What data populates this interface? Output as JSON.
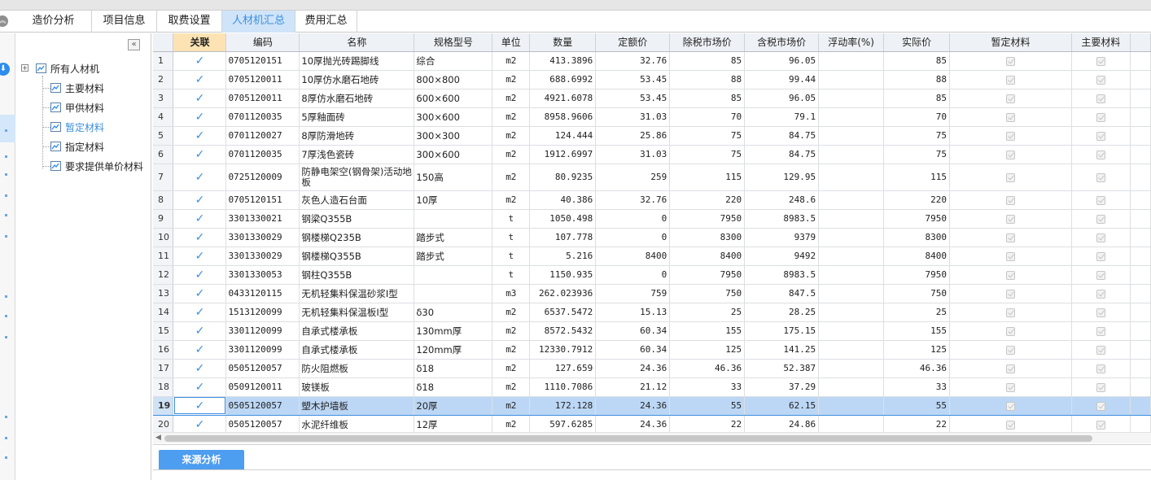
{
  "tabs": [
    {
      "label": "造价分析",
      "active": false
    },
    {
      "label": "项目信息",
      "active": false
    },
    {
      "label": "取费设置",
      "active": false
    },
    {
      "label": "人材机汇总",
      "active": true
    },
    {
      "label": "费用汇总",
      "active": false
    }
  ],
  "tree": {
    "root_label": "所有人材机",
    "items": [
      "主要材料",
      "甲供材料",
      "暂定材料",
      "指定材料",
      "要求提供单价材料"
    ],
    "selected": "暂定材料"
  },
  "grid": {
    "columns": [
      "关联",
      "编码",
      "名称",
      "规格型号",
      "单位",
      "数量",
      "定额价",
      "除税市场价",
      "含税市场价",
      "浮动率(%)",
      "实际价",
      "暂定材料",
      "主要材料"
    ],
    "selected_row": "19",
    "rows": [
      {
        "idx": "1",
        "code": "0705120151",
        "name": "10厚抛光砖踢脚线",
        "spec": "综合",
        "unit": "m2",
        "qty": "413.3896",
        "quota": "32.76",
        "ex_tax": "85",
        "inc_tax": "96.05",
        "float": "",
        "actual": "85"
      },
      {
        "idx": "2",
        "code": "0705120011",
        "name": "10厚仿水磨石地砖",
        "spec": "800×800",
        "unit": "m2",
        "qty": "688.6992",
        "quota": "53.45",
        "ex_tax": "88",
        "inc_tax": "99.44",
        "float": "",
        "actual": "88"
      },
      {
        "idx": "3",
        "code": "0705120011",
        "name": "8厚仿水磨石地砖",
        "spec": "600×600",
        "unit": "m2",
        "qty": "4921.6078",
        "quota": "53.45",
        "ex_tax": "85",
        "inc_tax": "96.05",
        "float": "",
        "actual": "85"
      },
      {
        "idx": "4",
        "code": "0701120035",
        "name": "5厚釉面砖",
        "spec": "300×600",
        "unit": "m2",
        "qty": "8958.9606",
        "quota": "31.03",
        "ex_tax": "70",
        "inc_tax": "79.1",
        "float": "",
        "actual": "70"
      },
      {
        "idx": "5",
        "code": "0701120027",
        "name": "8厚防滑地砖",
        "spec": "300×300",
        "unit": "m2",
        "qty": "124.444",
        "quota": "25.86",
        "ex_tax": "75",
        "inc_tax": "84.75",
        "float": "",
        "actual": "75"
      },
      {
        "idx": "6",
        "code": "0701120035",
        "name": "7厚浅色瓷砖",
        "spec": "300×600",
        "unit": "m2",
        "qty": "1912.6997",
        "quota": "31.03",
        "ex_tax": "75",
        "inc_tax": "84.75",
        "float": "",
        "actual": "75"
      },
      {
        "idx": "7",
        "code": "0725120009",
        "name": "防静电架空(钢骨架)活动地板",
        "spec": "150高",
        "unit": "m2",
        "qty": "80.9235",
        "quota": "259",
        "ex_tax": "115",
        "inc_tax": "129.95",
        "float": "",
        "actual": "115"
      },
      {
        "idx": "8",
        "code": "0705120151",
        "name": "灰色人造石台面",
        "spec": "10厚",
        "unit": "m2",
        "qty": "40.386",
        "quota": "32.76",
        "ex_tax": "220",
        "inc_tax": "248.6",
        "float": "",
        "actual": "220"
      },
      {
        "idx": "9",
        "code": "3301330021",
        "name": "钢梁Q355B",
        "spec": "",
        "unit": "t",
        "qty": "1050.498",
        "quota": "0",
        "ex_tax": "7950",
        "inc_tax": "8983.5",
        "float": "",
        "actual": "7950"
      },
      {
        "idx": "10",
        "code": "3301330029",
        "name": "钢楼梯Q235B",
        "spec": "踏步式",
        "unit": "t",
        "qty": "107.778",
        "quota": "0",
        "ex_tax": "8300",
        "inc_tax": "9379",
        "float": "",
        "actual": "8300"
      },
      {
        "idx": "11",
        "code": "3301330029",
        "name": "钢楼梯Q355B",
        "spec": "踏步式",
        "unit": "t",
        "qty": "5.216",
        "quota": "8400",
        "ex_tax": "8400",
        "inc_tax": "9492",
        "float": "",
        "actual": "8400"
      },
      {
        "idx": "12",
        "code": "3301330053",
        "name": "钢柱Q355B",
        "spec": "",
        "unit": "t",
        "qty": "1150.935",
        "quota": "0",
        "ex_tax": "7950",
        "inc_tax": "8983.5",
        "float": "",
        "actual": "7950"
      },
      {
        "idx": "13",
        "code": "0433120115",
        "name": "无机轻集料保温砂浆Ⅰ型",
        "spec": "",
        "unit": "m3",
        "qty": "262.023936",
        "quota": "759",
        "ex_tax": "750",
        "inc_tax": "847.5",
        "float": "",
        "actual": "750"
      },
      {
        "idx": "14",
        "code": "1513120099",
        "name": "无机轻集料保温板Ⅰ型",
        "spec": "δ30",
        "unit": "m2",
        "qty": "6537.5472",
        "quota": "15.13",
        "ex_tax": "25",
        "inc_tax": "28.25",
        "float": "",
        "actual": "25"
      },
      {
        "idx": "15",
        "code": "3301120099",
        "name": "自承式楼承板",
        "spec": "130mm厚",
        "unit": "m2",
        "qty": "8572.5432",
        "quota": "60.34",
        "ex_tax": "155",
        "inc_tax": "175.15",
        "float": "",
        "actual": "155"
      },
      {
        "idx": "16",
        "code": "3301120099",
        "name": "自承式楼承板",
        "spec": "120mm厚",
        "unit": "m2",
        "qty": "12330.7912",
        "quota": "60.34",
        "ex_tax": "125",
        "inc_tax": "141.25",
        "float": "",
        "actual": "125"
      },
      {
        "idx": "17",
        "code": "0505120057",
        "name": "防火阻燃板",
        "spec": "δ18",
        "unit": "m2",
        "qty": "127.659",
        "quota": "24.36",
        "ex_tax": "46.36",
        "inc_tax": "52.387",
        "float": "",
        "actual": "46.36"
      },
      {
        "idx": "18",
        "code": "0509120011",
        "name": "玻镁板",
        "spec": "δ18",
        "unit": "m2",
        "qty": "1110.7086",
        "quota": "21.12",
        "ex_tax": "33",
        "inc_tax": "37.29",
        "float": "",
        "actual": "33"
      },
      {
        "idx": "19",
        "code": "0505120057",
        "name": "塑木护墙板",
        "spec": "20厚",
        "unit": "m2",
        "qty": "172.128",
        "quota": "24.36",
        "ex_tax": "55",
        "inc_tax": "62.15",
        "float": "",
        "actual": "55"
      },
      {
        "idx": "20",
        "code": "0505120057",
        "name": "水泥纤维板",
        "spec": "12厚",
        "unit": "m2",
        "qty": "597.6285",
        "quota": "24.36",
        "ex_tax": "22",
        "inc_tax": "24.86",
        "float": "",
        "actual": "22"
      }
    ]
  },
  "bottom": {
    "source_analysis_label": "来源分析"
  },
  "icons": {
    "collapse": "chevron-left-icon",
    "check": "check-icon",
    "checkbox": "checkbox-icon",
    "folder": "folder-icon"
  },
  "colors": {
    "accent": "#3c8fde",
    "tab_active_bg": "#cfe4f8",
    "selected_row_bg": "#bcd7f5",
    "header_highlight": "#fde3b3",
    "button_bg": "#4d9df0"
  }
}
